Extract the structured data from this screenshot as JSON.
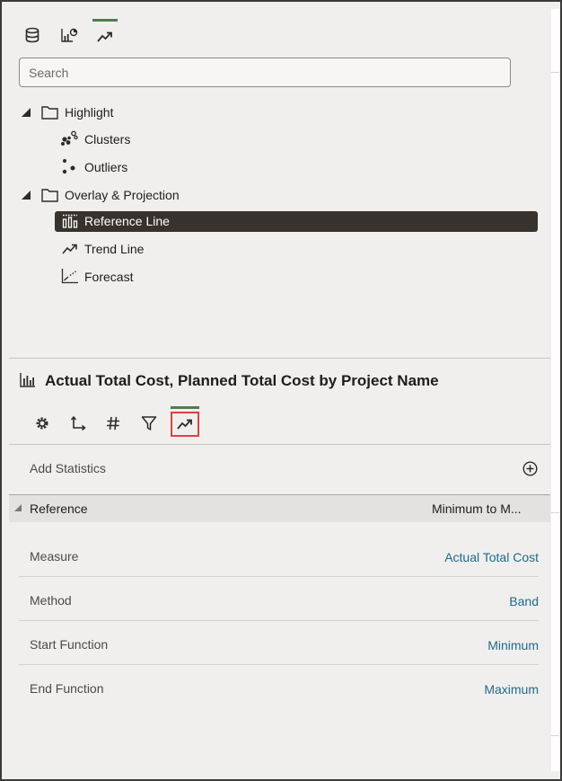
{
  "search": {
    "placeholder": "Search"
  },
  "tree": {
    "highlight": {
      "label": "Highlight",
      "items": [
        "Clusters",
        "Outliers"
      ]
    },
    "overlay": {
      "label": "Overlay & Projection",
      "items": [
        "Reference Line",
        "Trend Line",
        "Forecast"
      ],
      "selected": "Reference Line"
    }
  },
  "visualization": {
    "title": "Actual Total Cost, Planned Total Cost by Project Name"
  },
  "statistics": {
    "add_label": "Add Statistics",
    "reference": {
      "label": "Reference",
      "summary": "Minimum to M..."
    },
    "properties": [
      {
        "label": "Measure",
        "value": "Actual Total Cost"
      },
      {
        "label": "Method",
        "value": "Band"
      },
      {
        "label": "Start Function",
        "value": "Minimum"
      },
      {
        "label": "End Function",
        "value": "Maximum"
      }
    ]
  },
  "colors": {
    "accent_tab": "#4f7d4f",
    "selected_row": "#37322d",
    "link_value": "#1c6a8e",
    "highlight_box": "#e04040"
  }
}
